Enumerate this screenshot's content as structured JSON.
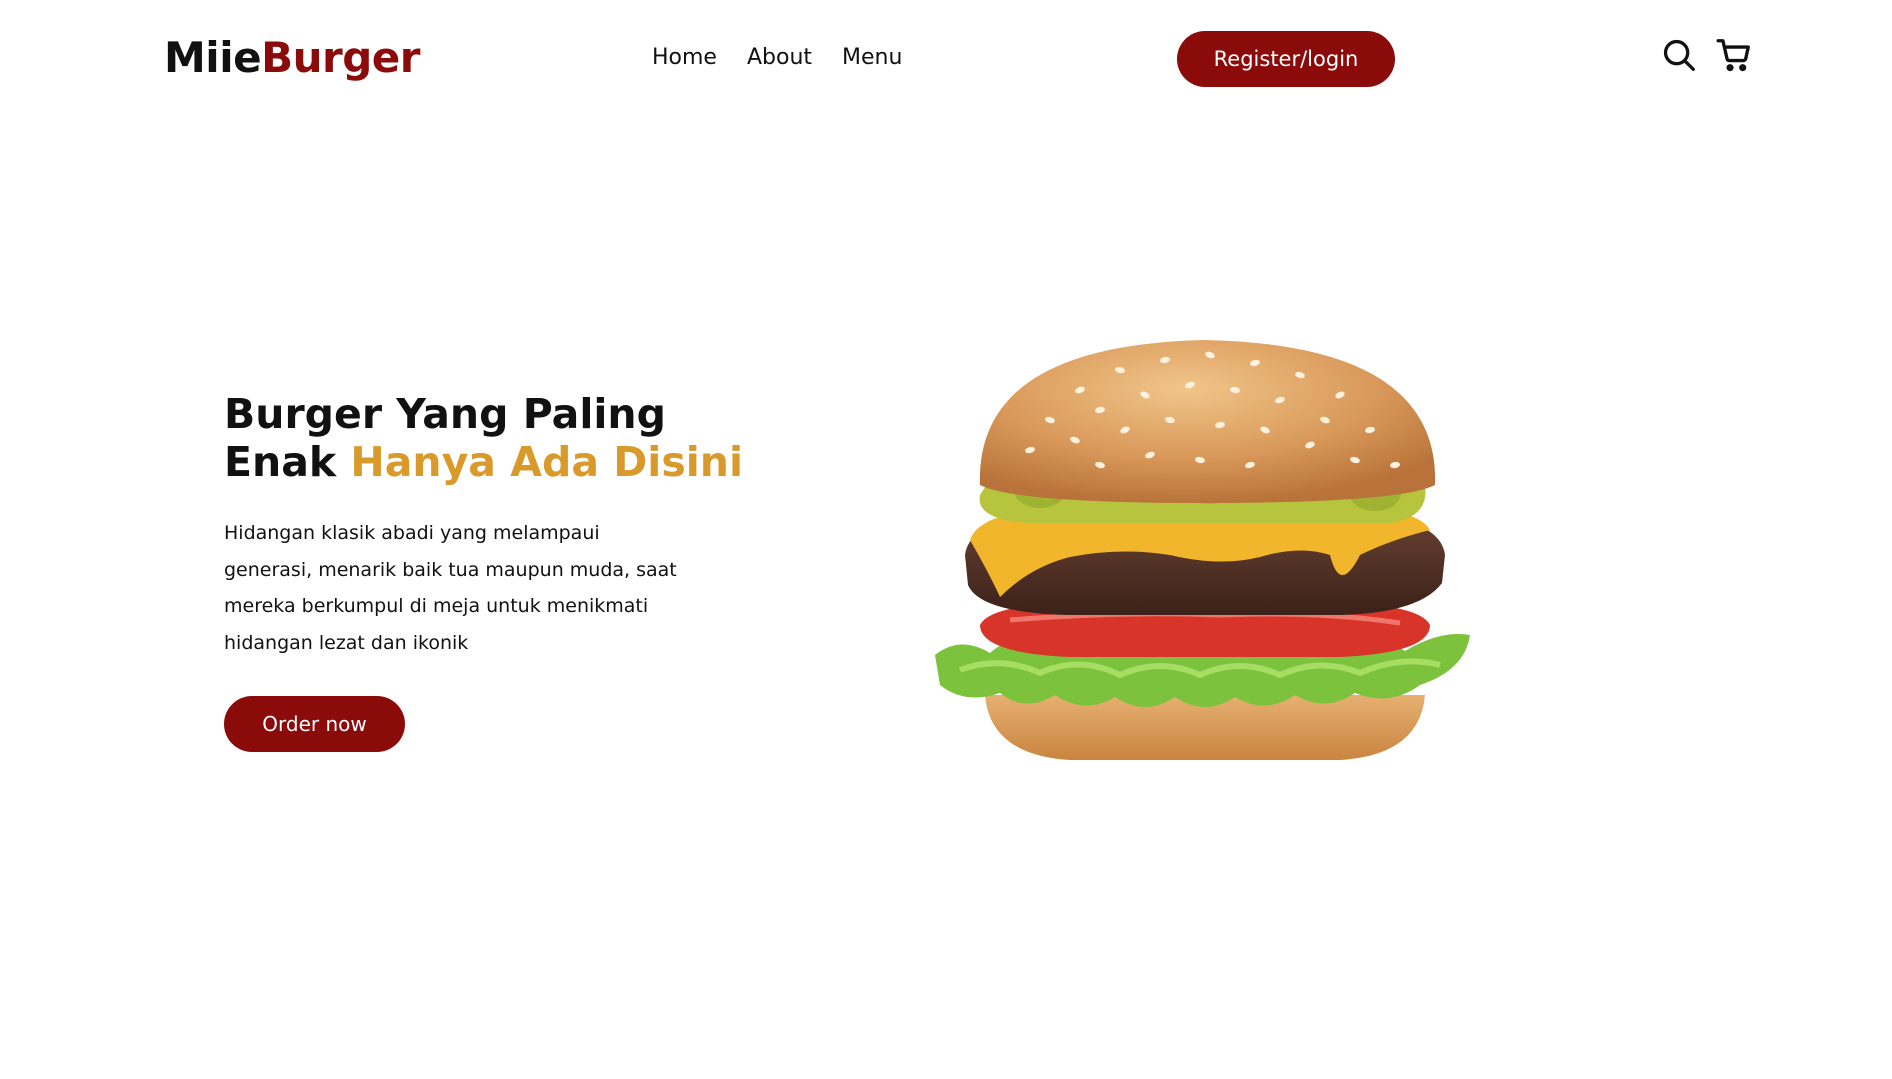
{
  "header": {
    "logo_part1": "Miie",
    "logo_part2": "Burger",
    "nav": [
      {
        "label": "Home"
      },
      {
        "label": "About"
      },
      {
        "label": "Menu"
      }
    ],
    "register_label": "Register/login",
    "icons": [
      "search-icon",
      "cart-icon"
    ]
  },
  "hero": {
    "title_line1": "Burger Yang Paling",
    "title_line2_plain": "Enak ",
    "title_line2_accent": "Hanya Ada Disini",
    "description": "Hidangan klasik abadi yang melampaui generasi, menarik baik tua maupun muda, saat mereka berkumpul di meja untuk menikmati hidangan lezat dan ikonik",
    "order_label": "Order now",
    "image": "burger-image"
  },
  "colors": {
    "brand": "#8b0a0a",
    "accent": "#d99a2b",
    "text": "#111111",
    "background": "#ffffff"
  }
}
